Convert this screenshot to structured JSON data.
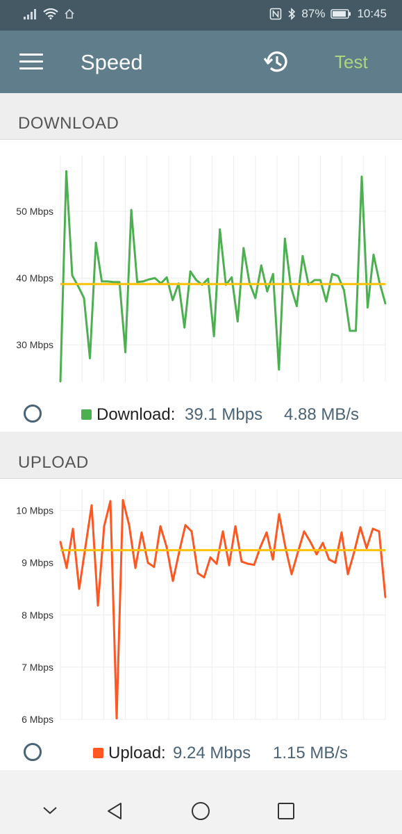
{
  "status_bar": {
    "battery": "87%",
    "time": "10:45"
  },
  "app_bar": {
    "title": "Speed",
    "test_label": "Test",
    "menu_icon": "hamburger-menu-icon",
    "history_icon": "history-icon"
  },
  "download": {
    "section_title": "DOWNLOAD",
    "legend_label": "Download:",
    "rate_mbps": "39.1 Mbps",
    "rate_mbytes": "4.88 MB/s",
    "color": "#4caf50"
  },
  "upload": {
    "section_title": "UPLOAD",
    "legend_label": "Upload:",
    "rate_mbps": "9.24 Mbps",
    "rate_mbytes": "1.15 MB/s",
    "color": "#ff5722"
  },
  "chart_data": [
    {
      "type": "line",
      "title": "",
      "ylabel": "",
      "ytick_labels": [
        "30 Mbps",
        "40 Mbps",
        "50 Mbps"
      ],
      "ytick_values": [
        30,
        40,
        50
      ],
      "ylim": [
        24.5,
        57.5
      ],
      "average": 39.1,
      "average_color": "#ffc107",
      "series": [
        {
          "color": "#4caf50",
          "values": [
            24.5,
            56,
            40.4,
            38.8,
            37,
            28,
            45.3,
            39.5,
            39.5,
            39.4,
            39.4,
            28.9,
            50.2,
            39.4,
            39.5,
            39.8,
            40,
            39.2,
            40.1,
            36.7,
            39.2,
            32.6,
            41,
            39.7,
            39,
            39.9,
            31.3,
            47.3,
            39,
            40.1,
            33.5,
            44.5,
            39.3,
            37,
            41.9,
            38,
            40.6,
            26.3,
            45.9,
            38.7,
            35.8,
            43.3,
            39,
            39.7,
            39.7,
            36.5,
            40.6,
            40.3,
            38.2,
            32.1,
            32.1,
            55.2,
            35.6,
            43.5,
            39.4,
            36.2
          ]
        }
      ]
    },
    {
      "type": "line",
      "title": "",
      "ylabel": "",
      "ytick_labels": [
        "6 Mbps",
        "7 Mbps",
        "8 Mbps",
        "9 Mbps",
        "10 Mbps"
      ],
      "ytick_values": [
        6,
        7,
        8,
        9,
        10
      ],
      "ylim": [
        6,
        10.3
      ],
      "average": 9.24,
      "average_color": "#ffc107",
      "series": [
        {
          "color": "#ff5722",
          "values": [
            9.4,
            8.9,
            9.65,
            8.5,
            9.3,
            10.1,
            8.18,
            9.7,
            10.18,
            6.02,
            10.2,
            9.72,
            8.9,
            9.58,
            9.0,
            8.92,
            9.7,
            9.3,
            8.65,
            9.2,
            9.72,
            9.6,
            8.8,
            8.72,
            9.1,
            8.98,
            9.6,
            8.95,
            9.7,
            9.02,
            8.98,
            8.96,
            9.3,
            9.58,
            9.06,
            9.93,
            9.3,
            8.78,
            9.2,
            9.6,
            9.4,
            9.16,
            9.38,
            9.06,
            9.0,
            9.58,
            8.78,
            9.2,
            9.68,
            9.28,
            9.65,
            9.6,
            8.34
          ]
        }
      ]
    }
  ]
}
